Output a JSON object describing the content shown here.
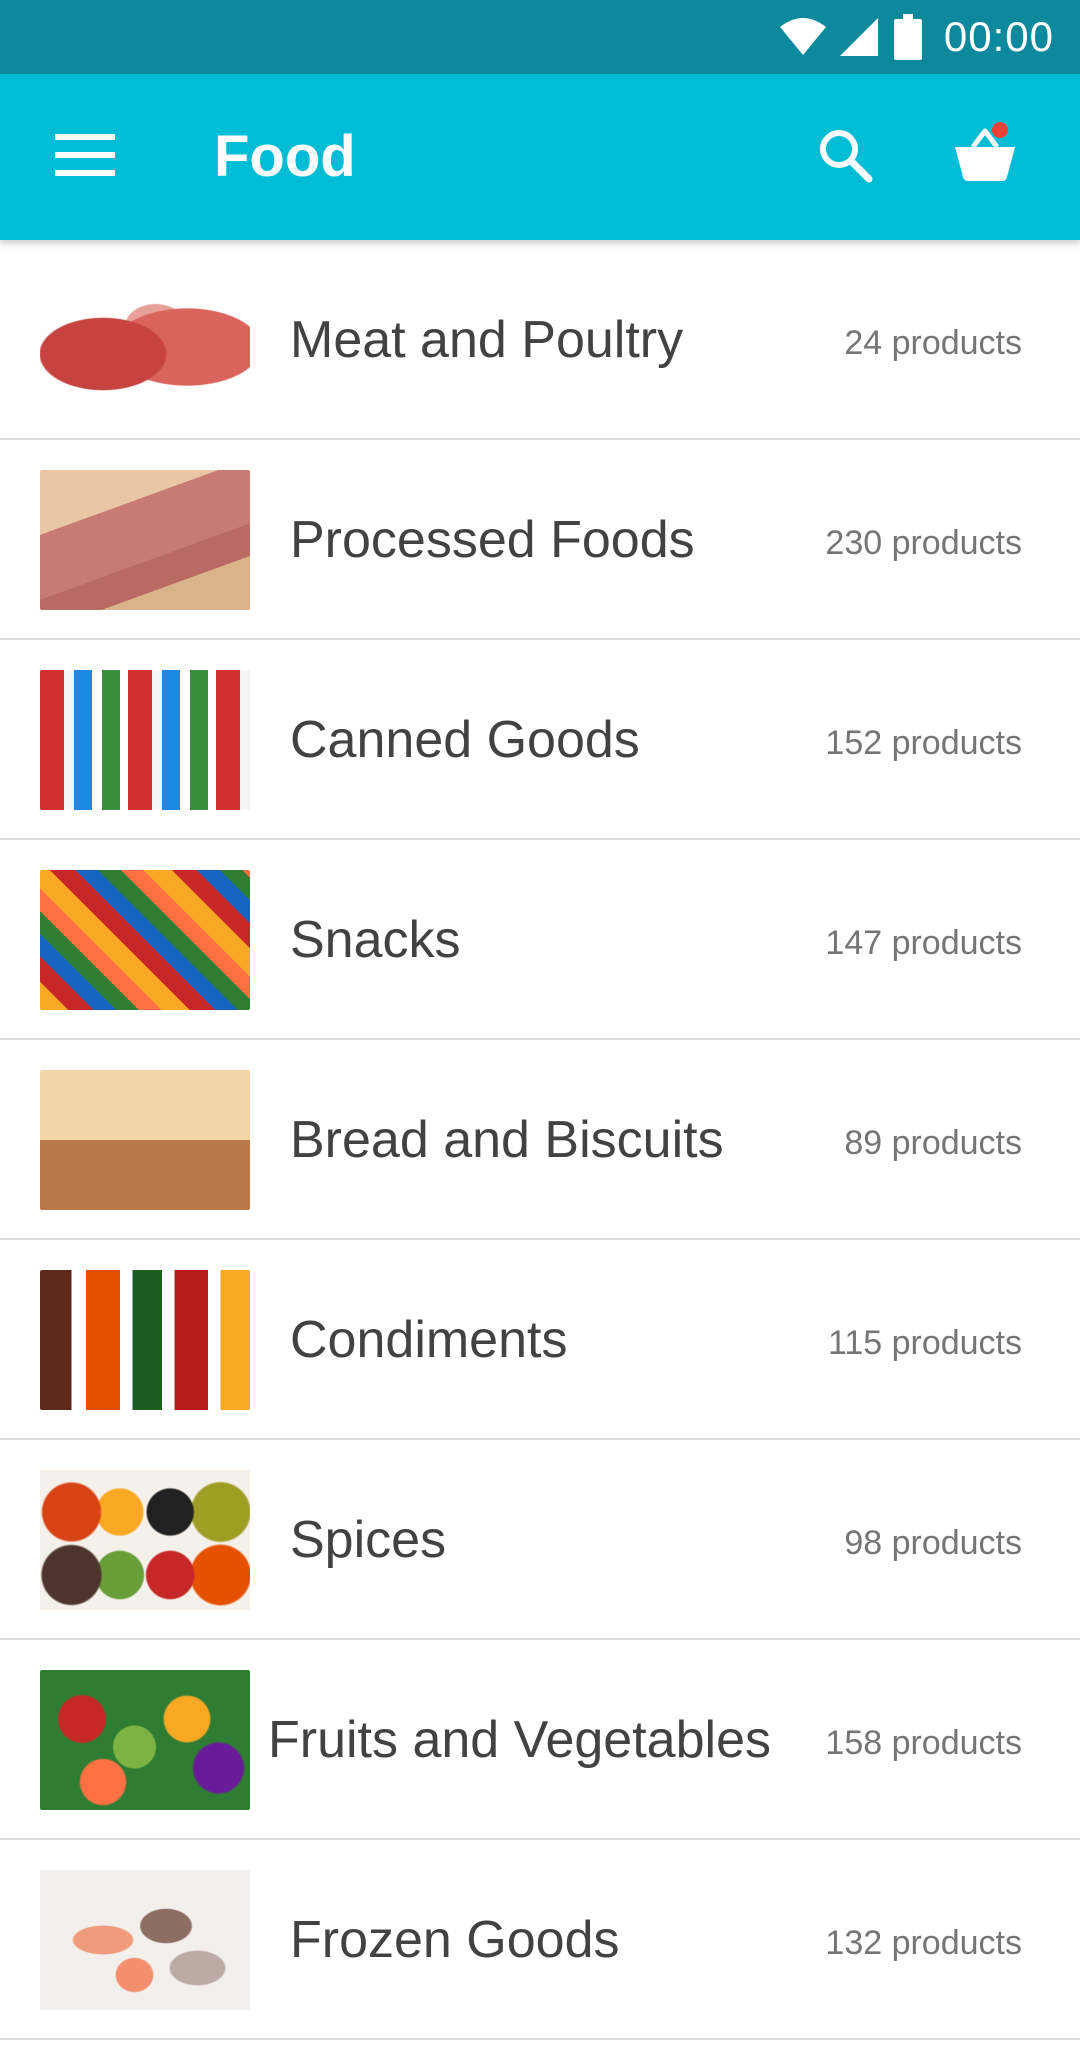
{
  "status_bar": {
    "time": "00:00"
  },
  "app_bar": {
    "title": "Food"
  },
  "categories": [
    {
      "name": "Meat and Poultry",
      "count": "24 products"
    },
    {
      "name": "Processed Foods",
      "count": "230 products"
    },
    {
      "name": "Canned Goods",
      "count": "152 products"
    },
    {
      "name": "Snacks",
      "count": "147 products"
    },
    {
      "name": "Bread and Biscuits",
      "count": "89 products"
    },
    {
      "name": "Condiments",
      "count": "115 products"
    },
    {
      "name": "Spices",
      "count": "98 products"
    },
    {
      "name": "Fruits and Vegetables",
      "count": "158 products"
    },
    {
      "name": "Frozen Goods",
      "count": "132 products"
    }
  ],
  "colors": {
    "status_bar": "#0c899d",
    "app_bar": "#00bcd4",
    "text_primary": "#424242",
    "text_secondary": "#757575",
    "cart_badge": "#f44336"
  },
  "icons": {
    "menu": "menu-icon",
    "search": "search-icon",
    "cart": "basket-icon",
    "wifi": "wifi-icon",
    "signal": "cell-signal-icon",
    "battery": "battery-icon"
  }
}
